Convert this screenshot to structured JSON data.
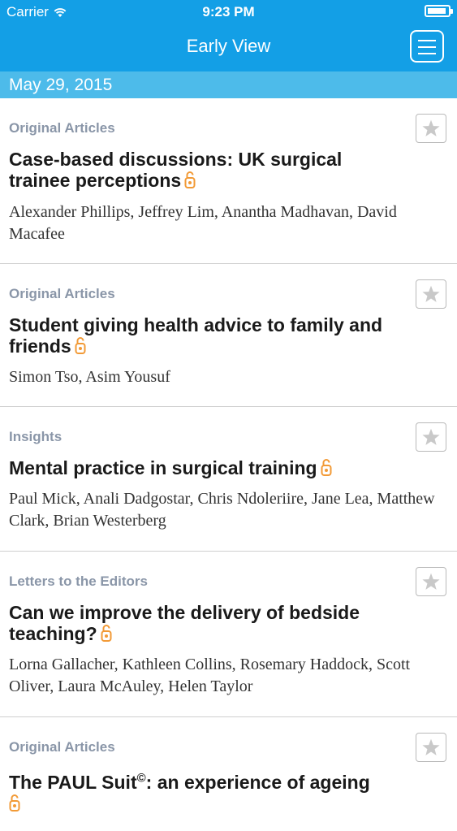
{
  "status_bar": {
    "carrier": "Carrier",
    "time": "9:23 PM",
    "battery_level": 0.9
  },
  "nav": {
    "title": "Early View",
    "menu_icon": "hamburger-menu-icon"
  },
  "date_header": "May 29, 2015",
  "colors": {
    "nav_bg": "#139fe6",
    "date_bg": "#4dbbea",
    "category": "#8a96a8",
    "lock": "#f29a36"
  },
  "articles": [
    {
      "category": "Original Articles",
      "title": "Case-based discussions: UK surgical trainee perceptions",
      "authors": "Alexander Phillips, Jeffrey Lim, Anantha Madhavan, David Macafee",
      "open_access": true
    },
    {
      "category": "Original Articles",
      "title": "Student giving health advice to family and friends",
      "authors": "Simon Tso, Asim Yousuf",
      "open_access": true
    },
    {
      "category": "Insights",
      "title": "Mental practice in surgical training",
      "authors": "Paul Mick, Anali Dadgostar, Chris Ndoleriire, Jane Lea, Matthew Clark, Brian Westerberg",
      "open_access": true
    },
    {
      "category": "Letters to the Editors",
      "title": "Can we improve the delivery of bedside teaching?",
      "authors": "Lorna Gallacher, Kathleen Collins, Rosemary Haddock, Scott Oliver, Laura McAuley, Helen Taylor",
      "open_access": true
    },
    {
      "category": "Original Articles",
      "title_prefix": "The PAUL Suit",
      "title_sup": "©",
      "title_suffix": ": an experience of ageing",
      "open_access": true
    }
  ]
}
